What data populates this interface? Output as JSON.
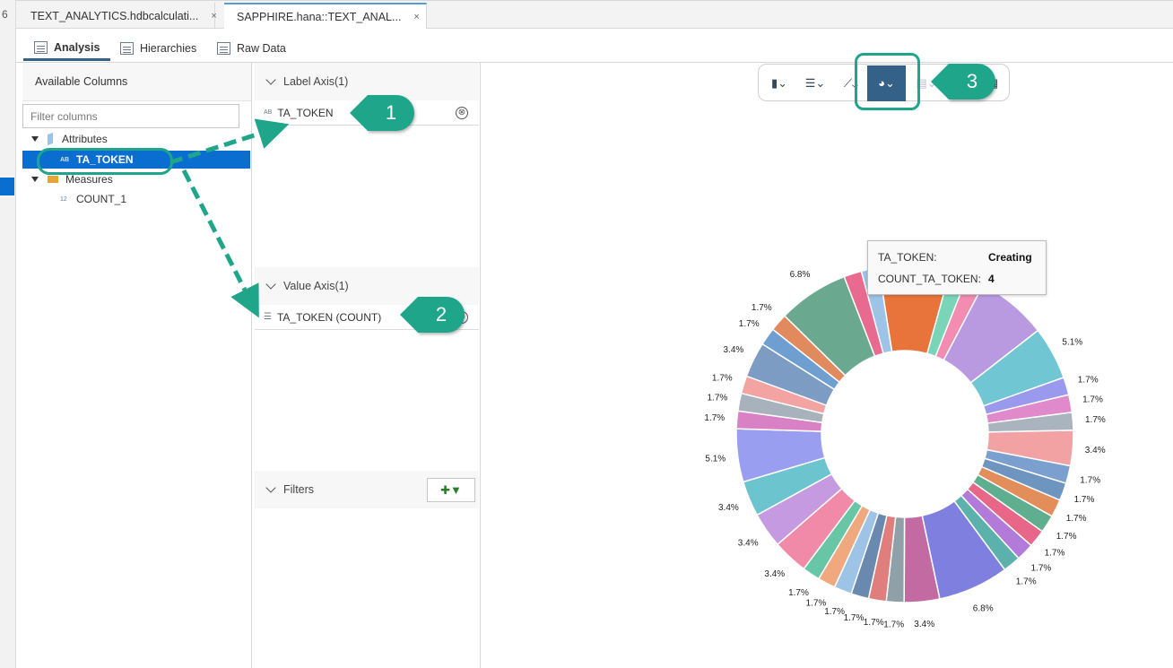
{
  "editor_tabs": [
    {
      "label": "TEXT_ANALYTICS.hdbcalculati..."
    },
    {
      "label": "SAPPHIRE.hana::TEXT_ANAL..."
    }
  ],
  "close_glyph": "×",
  "left_strip_glyph": "6",
  "view_tabs": [
    {
      "label": "Analysis",
      "active": true
    },
    {
      "label": "Hierarchies"
    },
    {
      "label": "Raw Data"
    }
  ],
  "available": {
    "title": "Available Columns",
    "filter_placeholder": "Filter columns",
    "attributes_label": "Attributes",
    "attribute_type": "AB",
    "attribute_item": "TA_TOKEN",
    "measures_label": "Measures",
    "measure_type": "12",
    "measure_item": "COUNT_1"
  },
  "label_axis": {
    "title": "Label Axis(1)",
    "type": "AB",
    "item": "TA_TOKEN"
  },
  "value_axis": {
    "title": "Value Axis(1)",
    "type": "☰",
    "item": "TA_TOKEN (COUNT)"
  },
  "filters": {
    "title": "Filters"
  },
  "remove_glyph": "⊗",
  "toolbar_icons": [
    "column-chart-icon",
    "bar-chart-icon",
    "line-chart-icon",
    "pie-chart-icon",
    "stacked-chart-icon",
    "table-icon"
  ],
  "tooltip": {
    "key1": "TA_TOKEN:",
    "val1": "Creating",
    "key2": "COUNT_TA_TOKEN:",
    "val2": "4"
  },
  "callouts": [
    "1",
    "2",
    "3"
  ],
  "colors": {
    "accent": "#1ea58a",
    "selected": "#0a6ed1",
    "toolbar_active": "#346187"
  },
  "chart_data": {
    "type": "pie",
    "donut": true,
    "slices": [
      {
        "value": 1.7,
        "label": "",
        "color": "#9dc3e6"
      },
      {
        "value": 6.8,
        "label": "",
        "color": "#e8743b"
      },
      {
        "value": 1.7,
        "label": "",
        "color": "#79d4b8"
      },
      {
        "value": 1.7,
        "label": "",
        "color": "#f28cb1"
      },
      {
        "value": 6.8,
        "label": "6.8%",
        "color": "#b99ae0"
      },
      {
        "value": 5.1,
        "label": "5.1%",
        "color": "#70c6d2"
      },
      {
        "value": 1.7,
        "label": "1.7%",
        "color": "#9999ee"
      },
      {
        "value": 1.7,
        "label": "1.7%",
        "color": "#e18acb"
      },
      {
        "value": 1.7,
        "label": "1.7%",
        "color": "#a9b4be"
      },
      {
        "value": 3.4,
        "label": "3.4%",
        "color": "#f2a2a2"
      },
      {
        "value": 1.7,
        "label": "1.7%",
        "color": "#7b9fce"
      },
      {
        "value": 1.7,
        "label": "1.7%",
        "color": "#6e95bf"
      },
      {
        "value": 1.7,
        "label": "1.7%",
        "color": "#e38d5b"
      },
      {
        "value": 1.7,
        "label": "1.7%",
        "color": "#5fae8f"
      },
      {
        "value": 1.7,
        "label": "1.7%",
        "color": "#e86688"
      },
      {
        "value": 1.7,
        "label": "1.7%",
        "color": "#b27ad9"
      },
      {
        "value": 1.7,
        "label": "1.7%",
        "color": "#5cb1ac"
      },
      {
        "value": 6.8,
        "label": "6.8%",
        "color": "#7f7fe0"
      },
      {
        "value": 3.4,
        "label": "3.4%",
        "color": "#c46aa3"
      },
      {
        "value": 1.7,
        "label": "1.7%",
        "color": "#8fa0a8"
      },
      {
        "value": 1.7,
        "label": "1.7%",
        "color": "#e07d7d"
      },
      {
        "value": 1.7,
        "label": "1.7%",
        "color": "#6a89ae"
      },
      {
        "value": 1.7,
        "label": "1.7%",
        "color": "#9dc3e6"
      },
      {
        "value": 1.7,
        "label": "1.7%",
        "color": "#f0a97f"
      },
      {
        "value": 1.7,
        "label": "1.7%",
        "color": "#68c5a5"
      },
      {
        "value": 3.4,
        "label": "3.4%",
        "color": "#f08aa8"
      },
      {
        "value": 3.4,
        "label": "3.4%",
        "color": "#c59ae0"
      },
      {
        "value": 3.4,
        "label": "3.4%",
        "color": "#6cc4cf"
      },
      {
        "value": 5.1,
        "label": "5.1%",
        "color": "#9a9ef0"
      },
      {
        "value": 1.7,
        "label": "1.7%",
        "color": "#d881c4"
      },
      {
        "value": 1.7,
        "label": "1.7%",
        "color": "#a8b2bc"
      },
      {
        "value": 1.7,
        "label": "1.7%",
        "color": "#f4a3a3"
      },
      {
        "value": 3.4,
        "label": "3.4%",
        "color": "#7d9cc4"
      },
      {
        "value": 1.7,
        "label": "1.7%",
        "color": "#6f9ed1"
      },
      {
        "value": 1.7,
        "label": "1.7%",
        "color": "#e18a5e"
      },
      {
        "value": 6.8,
        "label": "6.8%",
        "color": "#6aa98f"
      },
      {
        "value": 1.7,
        "label": "",
        "color": "#e86a91"
      }
    ]
  }
}
